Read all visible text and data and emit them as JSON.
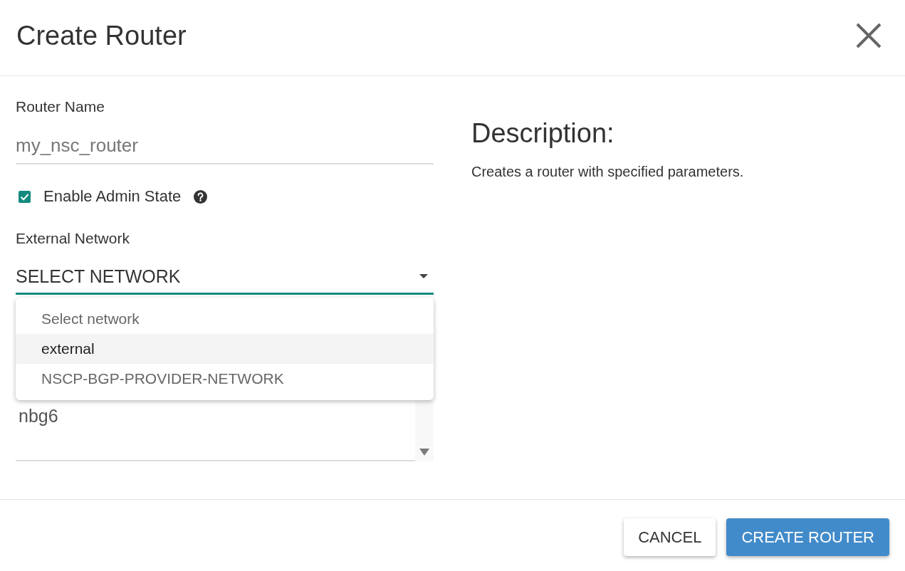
{
  "dialog": {
    "title": "Create Router"
  },
  "form": {
    "router_name": {
      "label": "Router Name",
      "placeholder": "my_nsc_router"
    },
    "admin_state": {
      "label": "Enable Admin State",
      "checked": true
    },
    "external_network": {
      "label": "External Network",
      "value": "SELECT NETWORK",
      "expanded": true,
      "options": [
        {
          "label": "Select network",
          "selected": false
        },
        {
          "label": "external",
          "selected": true
        },
        {
          "label": "NSCP-BGP-PROVIDER-NETWORK",
          "selected": false
        }
      ]
    },
    "list": {
      "items": [
        {
          "label": "nbg6"
        }
      ]
    }
  },
  "description": {
    "heading": "Description:",
    "text": "Creates a router with specified parameters."
  },
  "buttons": [
    {
      "label": "CANCEL",
      "kind": "secondary"
    },
    {
      "label": "CREATE ROUTER",
      "kind": "primary"
    }
  ]
}
